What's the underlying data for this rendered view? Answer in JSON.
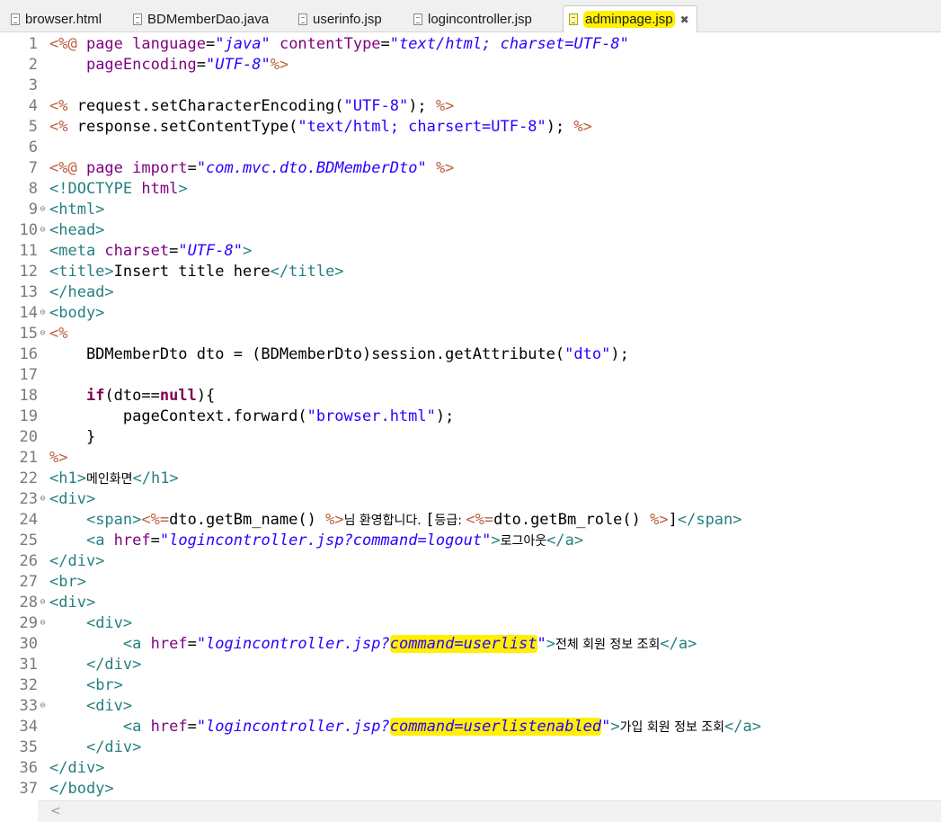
{
  "tabs": [
    {
      "label": "browser.html",
      "active": false
    },
    {
      "label": "BDMemberDao.java",
      "active": false
    },
    {
      "label": "userinfo.jsp",
      "active": false
    },
    {
      "label": "logincontroller.jsp",
      "active": false
    },
    {
      "label": "adminpage.jsp",
      "active": true,
      "close": "✖"
    }
  ],
  "icons": {
    "file": "file-icon",
    "close": "close-icon",
    "fold": "fold-collapse-icon",
    "scroll_left": "scroll-left-arrow-icon"
  },
  "colors": {
    "highlight": "#fff000",
    "jsp_delimiter": "#bf5f3f",
    "html_tag": "#267f7f",
    "attribute": "#7f007f",
    "string": "#2a00ff",
    "keyword": "#7f0055",
    "line_number": "#7a7a7a"
  },
  "code": {
    "lines": [
      {
        "n": "1",
        "fold": "",
        "segs": [
          [
            "jsp",
            "<%@ "
          ],
          [
            "kw2",
            "page "
          ],
          [
            "attr",
            "language"
          ],
          [
            "plain",
            "="
          ],
          [
            "str",
            "\"java\""
          ],
          [
            "plain",
            " "
          ],
          [
            "attr",
            "contentType"
          ],
          [
            "plain",
            "="
          ],
          [
            "str",
            "\"text/html; charset=UTF-8\""
          ]
        ]
      },
      {
        "n": "2",
        "fold": "",
        "segs": [
          [
            "plain",
            "    "
          ],
          [
            "attr",
            "pageEncoding"
          ],
          [
            "plain",
            "="
          ],
          [
            "str",
            "\"UTF-8\""
          ],
          [
            "jsp",
            "%>"
          ]
        ]
      },
      {
        "n": "3",
        "fold": "",
        "segs": []
      },
      {
        "n": "4",
        "fold": "",
        "segs": [
          [
            "jsp",
            "<%"
          ],
          [
            "plain",
            " request.setCharacterEncoding("
          ],
          [
            "jstr",
            "\"UTF-8\""
          ],
          [
            "plain",
            "); "
          ],
          [
            "jsp",
            "%>"
          ]
        ]
      },
      {
        "n": "5",
        "fold": "",
        "segs": [
          [
            "jsp",
            "<%"
          ],
          [
            "plain",
            " response.setContentType("
          ],
          [
            "jstr",
            "\"text/html; charsert=UTF-8\""
          ],
          [
            "plain",
            "); "
          ],
          [
            "jsp",
            "%>"
          ]
        ]
      },
      {
        "n": "6",
        "fold": "",
        "segs": []
      },
      {
        "n": "7",
        "fold": "",
        "segs": [
          [
            "jsp",
            "<%@ "
          ],
          [
            "kw2",
            "page "
          ],
          [
            "attr",
            "import"
          ],
          [
            "plain",
            "="
          ],
          [
            "str",
            "\"com.mvc.dto.BDMemberDto\""
          ],
          [
            "plain",
            " "
          ],
          [
            "jsp",
            "%>"
          ]
        ]
      },
      {
        "n": "8",
        "fold": "",
        "segs": [
          [
            "tag",
            "<!DOCTYPE "
          ],
          [
            "dt",
            "html"
          ],
          [
            "tag",
            ">"
          ]
        ]
      },
      {
        "n": "9",
        "fold": "⊖",
        "segs": [
          [
            "tag",
            "<html>"
          ]
        ]
      },
      {
        "n": "10",
        "fold": "⊖",
        "segs": [
          [
            "tag",
            "<head>"
          ]
        ]
      },
      {
        "n": "11",
        "fold": "",
        "segs": [
          [
            "tag",
            "<meta "
          ],
          [
            "attr",
            "charset"
          ],
          [
            "plain",
            "="
          ],
          [
            "str",
            "\"UTF-8\""
          ],
          [
            "tag",
            ">"
          ]
        ]
      },
      {
        "n": "12",
        "fold": "",
        "segs": [
          [
            "tag",
            "<title>"
          ],
          [
            "plain",
            "Insert title here"
          ],
          [
            "tag",
            "</title>"
          ]
        ]
      },
      {
        "n": "13",
        "fold": "",
        "segs": [
          [
            "tag",
            "</head>"
          ]
        ]
      },
      {
        "n": "14",
        "fold": "⊖",
        "segs": [
          [
            "tag",
            "<body>"
          ]
        ]
      },
      {
        "n": "15",
        "fold": "⊖",
        "segs": [
          [
            "jsp",
            "<%"
          ]
        ]
      },
      {
        "n": "16",
        "fold": "",
        "segs": [
          [
            "plain",
            "    BDMemberDto dto = (BDMemberDto)session.getAttribute("
          ],
          [
            "jstr",
            "\"dto\""
          ],
          [
            "plain",
            ");"
          ]
        ]
      },
      {
        "n": "17",
        "fold": "",
        "segs": []
      },
      {
        "n": "18",
        "fold": "",
        "segs": [
          [
            "plain",
            "    "
          ],
          [
            "kw",
            "if"
          ],
          [
            "plain",
            "(dto=="
          ],
          [
            "kw",
            "null"
          ],
          [
            "plain",
            "){"
          ]
        ]
      },
      {
        "n": "19",
        "fold": "",
        "segs": [
          [
            "plain",
            "        pageContext.forward("
          ],
          [
            "jstr",
            "\"browser.html\""
          ],
          [
            "plain",
            ");"
          ]
        ]
      },
      {
        "n": "20",
        "fold": "",
        "segs": [
          [
            "plain",
            "    }"
          ]
        ]
      },
      {
        "n": "21",
        "fold": "",
        "segs": [
          [
            "jsp",
            "%>"
          ]
        ]
      },
      {
        "n": "22",
        "fold": "",
        "segs": [
          [
            "tag",
            "<h1>"
          ],
          [
            "kr",
            "메인화면"
          ],
          [
            "tag",
            "</h1>"
          ]
        ]
      },
      {
        "n": "23",
        "fold": "⊖",
        "segs": [
          [
            "tag",
            "<div>"
          ]
        ]
      },
      {
        "n": "24",
        "fold": "",
        "segs": [
          [
            "plain",
            "    "
          ],
          [
            "tag",
            "<span>"
          ],
          [
            "jsp",
            "<%="
          ],
          [
            "plain",
            "dto.getBm_name() "
          ],
          [
            "jsp",
            "%>"
          ],
          [
            "kr",
            "님 환영합니다. "
          ],
          [
            "plain",
            "["
          ],
          [
            "kr",
            "등급: "
          ],
          [
            "jsp",
            "<%="
          ],
          [
            "plain",
            "dto.getBm_role() "
          ],
          [
            "jsp",
            "%>"
          ],
          [
            "plain",
            "]"
          ],
          [
            "tag",
            "</span>"
          ]
        ]
      },
      {
        "n": "25",
        "fold": "",
        "segs": [
          [
            "plain",
            "    "
          ],
          [
            "tag",
            "<a "
          ],
          [
            "attr",
            "href"
          ],
          [
            "plain",
            "="
          ],
          [
            "str",
            "\"logincontroller.jsp?command=logout\""
          ],
          [
            "tag",
            ">"
          ],
          [
            "kr",
            "로그아웃"
          ],
          [
            "tag",
            "</a>"
          ]
        ]
      },
      {
        "n": "26",
        "fold": "",
        "segs": [
          [
            "tag",
            "</div>"
          ]
        ]
      },
      {
        "n": "27",
        "fold": "",
        "segs": [
          [
            "tag",
            "<br>"
          ]
        ]
      },
      {
        "n": "28",
        "fold": "⊖",
        "segs": [
          [
            "tag",
            "<div>"
          ]
        ]
      },
      {
        "n": "29",
        "fold": "⊖",
        "segs": [
          [
            "plain",
            "    "
          ],
          [
            "tag",
            "<div>"
          ]
        ]
      },
      {
        "n": "30",
        "fold": "",
        "segs": [
          [
            "plain",
            "        "
          ],
          [
            "tag",
            "<a "
          ],
          [
            "attr",
            "href"
          ],
          [
            "plain",
            "="
          ],
          [
            "str",
            "\"logincontroller.jsp?"
          ],
          [
            "strhl",
            "command=userlist"
          ],
          [
            "str",
            "\""
          ],
          [
            "tag",
            ">"
          ],
          [
            "kr",
            "전체 회원 정보 조회"
          ],
          [
            "tag",
            "</a>"
          ]
        ]
      },
      {
        "n": "31",
        "fold": "",
        "segs": [
          [
            "plain",
            "    "
          ],
          [
            "tag",
            "</div>"
          ]
        ]
      },
      {
        "n": "32",
        "fold": "",
        "segs": [
          [
            "plain",
            "    "
          ],
          [
            "tag",
            "<br>"
          ]
        ]
      },
      {
        "n": "33",
        "fold": "⊖",
        "segs": [
          [
            "plain",
            "    "
          ],
          [
            "tag",
            "<div>"
          ]
        ]
      },
      {
        "n": "34",
        "fold": "",
        "segs": [
          [
            "plain",
            "        "
          ],
          [
            "tag",
            "<a "
          ],
          [
            "attr",
            "href"
          ],
          [
            "plain",
            "="
          ],
          [
            "str",
            "\"logincontroller.jsp?"
          ],
          [
            "strhl",
            "command=userlistenabled"
          ],
          [
            "str",
            "\""
          ],
          [
            "tag",
            ">"
          ],
          [
            "kr",
            "가입 회원 정보 조회"
          ],
          [
            "tag",
            "</a>"
          ]
        ]
      },
      {
        "n": "35",
        "fold": "",
        "segs": [
          [
            "plain",
            "    "
          ],
          [
            "tag",
            "</div>"
          ]
        ]
      },
      {
        "n": "36",
        "fold": "",
        "segs": [
          [
            "tag",
            "</div>"
          ]
        ]
      },
      {
        "n": "37",
        "fold": "",
        "segs": [
          [
            "tag",
            "</body>"
          ]
        ]
      }
    ]
  },
  "scrollbar": {
    "left_arrow": "<"
  }
}
